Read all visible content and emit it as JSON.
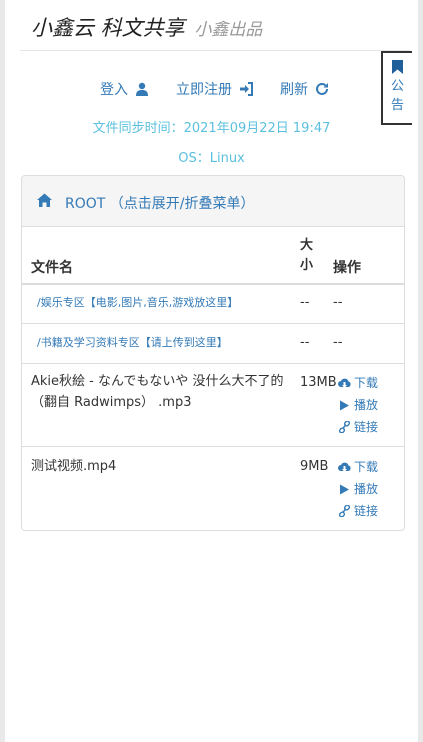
{
  "header": {
    "brand": "小鑫云 科文共享",
    "brand_sub": "小鑫出品"
  },
  "nav": {
    "login": "登入",
    "register": "立即注册",
    "refresh": "刷新"
  },
  "sync_time": "文件同步时间：2021年09月22日 19:47",
  "os": "OS：Linux",
  "notice": {
    "label": "公告"
  },
  "panel": {
    "title": "ROOT （点击展开/折叠菜单）"
  },
  "table": {
    "headers": {
      "name": "文件名",
      "size": "大小",
      "actions": "操作"
    },
    "rows": [
      {
        "name": "/娱乐专区【电影,图片,音乐,游戏放这里】",
        "size": "--",
        "actions": "--"
      },
      {
        "name": "/书籍及学习资料专区【请上传到这里】",
        "size": "--",
        "actions": "--"
      },
      {
        "name": "Akie秋絵 - なんでもないや 没什么大不了的（翻自 Radwimps） .mp3",
        "size": "13MB",
        "download": "下载",
        "play": "播放",
        "link": "链接"
      },
      {
        "name": "测试视频.mp4",
        "size": "9MB",
        "download": "下载",
        "play": "播放",
        "link": "链接"
      }
    ]
  },
  "colors": {
    "link": "#337ab7",
    "info": "#5bc0de"
  },
  "icons": [
    "user-icon",
    "sign-in-icon",
    "refresh-icon",
    "bookmark-icon",
    "home-icon",
    "cloud-download-icon",
    "play-icon",
    "link-icon"
  ]
}
